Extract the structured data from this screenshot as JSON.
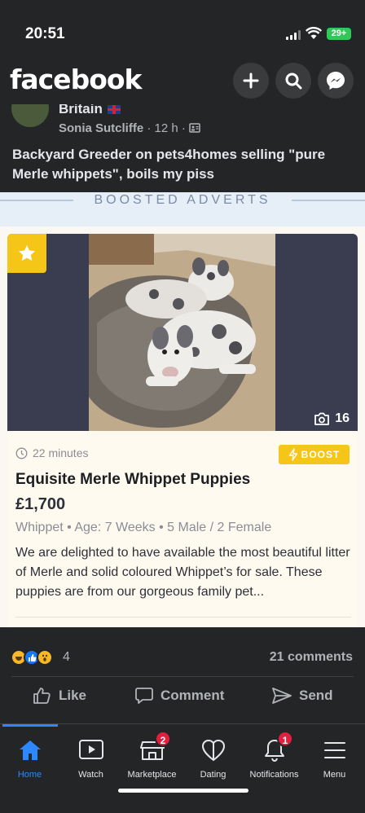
{
  "status_bar": {
    "time": "20:51",
    "battery": "29+"
  },
  "header": {
    "logo": "facebook",
    "icons": [
      "plus-icon",
      "search-icon",
      "messenger-icon"
    ]
  },
  "post": {
    "group_name": "Britain",
    "author": "Sonia Sutcliffe",
    "time_ago": "12 h",
    "separator": "·",
    "text": "Backyard Greeder on pets4homes selling \"pure Merle whippets\", boils my piss"
  },
  "boosted": {
    "label": "BOOSTED ADVERTS"
  },
  "ad": {
    "photo_count": "16",
    "posted": "22 minutes",
    "boost_label": "BOOST",
    "title": "Equisite Merle Whippet Puppies",
    "price": "£1,700",
    "breed": "Whippet",
    "age": "Age: 7 Weeks",
    "litter": "5 Male / 2 Female",
    "bullet": "•",
    "description": "We are delighted to have available the most beautiful litter of Merle and solid coloured Whippet’s for sale. These puppies are from our gorgeous family pet..."
  },
  "engagement": {
    "reaction_count": "4",
    "comments": "21 comments",
    "reactions": [
      "haha",
      "like",
      "wow"
    ]
  },
  "actions": {
    "like": "Like",
    "comment": "Comment",
    "send": "Send"
  },
  "tabs": [
    {
      "label": "Home",
      "icon": "home-icon",
      "active": true
    },
    {
      "label": "Watch",
      "icon": "watch-icon"
    },
    {
      "label": "Marketplace",
      "icon": "marketplace-icon",
      "badge": "2"
    },
    {
      "label": "Dating",
      "icon": "dating-icon"
    },
    {
      "label": "Notifications",
      "icon": "bell-icon",
      "badge": "1"
    },
    {
      "label": "Menu",
      "icon": "menu-icon"
    }
  ],
  "colors": {
    "accent": "#2d88ff",
    "boost_yellow": "#f5c518",
    "badge_red": "#e41e3f",
    "surface": "#242526"
  }
}
